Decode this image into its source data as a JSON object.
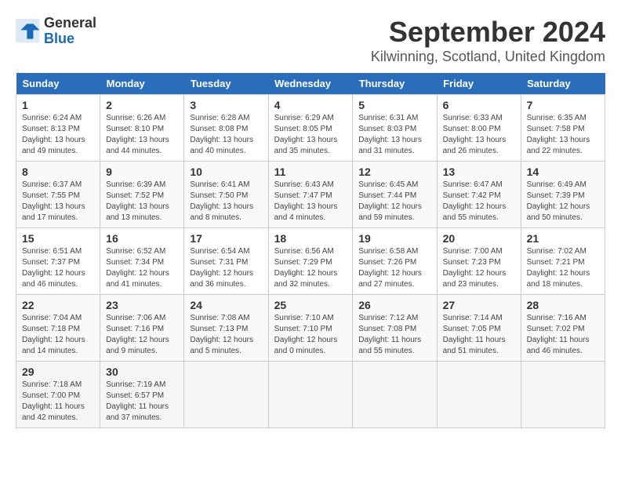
{
  "header": {
    "logo_general": "General",
    "logo_blue": "Blue",
    "month": "September 2024",
    "location": "Kilwinning, Scotland, United Kingdom"
  },
  "weekdays": [
    "Sunday",
    "Monday",
    "Tuesday",
    "Wednesday",
    "Thursday",
    "Friday",
    "Saturday"
  ],
  "weeks": [
    [
      {
        "day": "1",
        "sunrise": "Sunrise: 6:24 AM",
        "sunset": "Sunset: 8:13 PM",
        "daylight": "Daylight: 13 hours and 49 minutes."
      },
      {
        "day": "2",
        "sunrise": "Sunrise: 6:26 AM",
        "sunset": "Sunset: 8:10 PM",
        "daylight": "Daylight: 13 hours and 44 minutes."
      },
      {
        "day": "3",
        "sunrise": "Sunrise: 6:28 AM",
        "sunset": "Sunset: 8:08 PM",
        "daylight": "Daylight: 13 hours and 40 minutes."
      },
      {
        "day": "4",
        "sunrise": "Sunrise: 6:29 AM",
        "sunset": "Sunset: 8:05 PM",
        "daylight": "Daylight: 13 hours and 35 minutes."
      },
      {
        "day": "5",
        "sunrise": "Sunrise: 6:31 AM",
        "sunset": "Sunset: 8:03 PM",
        "daylight": "Daylight: 13 hours and 31 minutes."
      },
      {
        "day": "6",
        "sunrise": "Sunrise: 6:33 AM",
        "sunset": "Sunset: 8:00 PM",
        "daylight": "Daylight: 13 hours and 26 minutes."
      },
      {
        "day": "7",
        "sunrise": "Sunrise: 6:35 AM",
        "sunset": "Sunset: 7:58 PM",
        "daylight": "Daylight: 13 hours and 22 minutes."
      }
    ],
    [
      {
        "day": "8",
        "sunrise": "Sunrise: 6:37 AM",
        "sunset": "Sunset: 7:55 PM",
        "daylight": "Daylight: 13 hours and 17 minutes."
      },
      {
        "day": "9",
        "sunrise": "Sunrise: 6:39 AM",
        "sunset": "Sunset: 7:52 PM",
        "daylight": "Daylight: 13 hours and 13 minutes."
      },
      {
        "day": "10",
        "sunrise": "Sunrise: 6:41 AM",
        "sunset": "Sunset: 7:50 PM",
        "daylight": "Daylight: 13 hours and 8 minutes."
      },
      {
        "day": "11",
        "sunrise": "Sunrise: 6:43 AM",
        "sunset": "Sunset: 7:47 PM",
        "daylight": "Daylight: 13 hours and 4 minutes."
      },
      {
        "day": "12",
        "sunrise": "Sunrise: 6:45 AM",
        "sunset": "Sunset: 7:44 PM",
        "daylight": "Daylight: 12 hours and 59 minutes."
      },
      {
        "day": "13",
        "sunrise": "Sunrise: 6:47 AM",
        "sunset": "Sunset: 7:42 PM",
        "daylight": "Daylight: 12 hours and 55 minutes."
      },
      {
        "day": "14",
        "sunrise": "Sunrise: 6:49 AM",
        "sunset": "Sunset: 7:39 PM",
        "daylight": "Daylight: 12 hours and 50 minutes."
      }
    ],
    [
      {
        "day": "15",
        "sunrise": "Sunrise: 6:51 AM",
        "sunset": "Sunset: 7:37 PM",
        "daylight": "Daylight: 12 hours and 46 minutes."
      },
      {
        "day": "16",
        "sunrise": "Sunrise: 6:52 AM",
        "sunset": "Sunset: 7:34 PM",
        "daylight": "Daylight: 12 hours and 41 minutes."
      },
      {
        "day": "17",
        "sunrise": "Sunrise: 6:54 AM",
        "sunset": "Sunset: 7:31 PM",
        "daylight": "Daylight: 12 hours and 36 minutes."
      },
      {
        "day": "18",
        "sunrise": "Sunrise: 6:56 AM",
        "sunset": "Sunset: 7:29 PM",
        "daylight": "Daylight: 12 hours and 32 minutes."
      },
      {
        "day": "19",
        "sunrise": "Sunrise: 6:58 AM",
        "sunset": "Sunset: 7:26 PM",
        "daylight": "Daylight: 12 hours and 27 minutes."
      },
      {
        "day": "20",
        "sunrise": "Sunrise: 7:00 AM",
        "sunset": "Sunset: 7:23 PM",
        "daylight": "Daylight: 12 hours and 23 minutes."
      },
      {
        "day": "21",
        "sunrise": "Sunrise: 7:02 AM",
        "sunset": "Sunset: 7:21 PM",
        "daylight": "Daylight: 12 hours and 18 minutes."
      }
    ],
    [
      {
        "day": "22",
        "sunrise": "Sunrise: 7:04 AM",
        "sunset": "Sunset: 7:18 PM",
        "daylight": "Daylight: 12 hours and 14 minutes."
      },
      {
        "day": "23",
        "sunrise": "Sunrise: 7:06 AM",
        "sunset": "Sunset: 7:16 PM",
        "daylight": "Daylight: 12 hours and 9 minutes."
      },
      {
        "day": "24",
        "sunrise": "Sunrise: 7:08 AM",
        "sunset": "Sunset: 7:13 PM",
        "daylight": "Daylight: 12 hours and 5 minutes."
      },
      {
        "day": "25",
        "sunrise": "Sunrise: 7:10 AM",
        "sunset": "Sunset: 7:10 PM",
        "daylight": "Daylight: 12 hours and 0 minutes."
      },
      {
        "day": "26",
        "sunrise": "Sunrise: 7:12 AM",
        "sunset": "Sunset: 7:08 PM",
        "daylight": "Daylight: 11 hours and 55 minutes."
      },
      {
        "day": "27",
        "sunrise": "Sunrise: 7:14 AM",
        "sunset": "Sunset: 7:05 PM",
        "daylight": "Daylight: 11 hours and 51 minutes."
      },
      {
        "day": "28",
        "sunrise": "Sunrise: 7:16 AM",
        "sunset": "Sunset: 7:02 PM",
        "daylight": "Daylight: 11 hours and 46 minutes."
      }
    ],
    [
      {
        "day": "29",
        "sunrise": "Sunrise: 7:18 AM",
        "sunset": "Sunset: 7:00 PM",
        "daylight": "Daylight: 11 hours and 42 minutes."
      },
      {
        "day": "30",
        "sunrise": "Sunrise: 7:19 AM",
        "sunset": "Sunset: 6:57 PM",
        "daylight": "Daylight: 11 hours and 37 minutes."
      },
      null,
      null,
      null,
      null,
      null
    ]
  ]
}
